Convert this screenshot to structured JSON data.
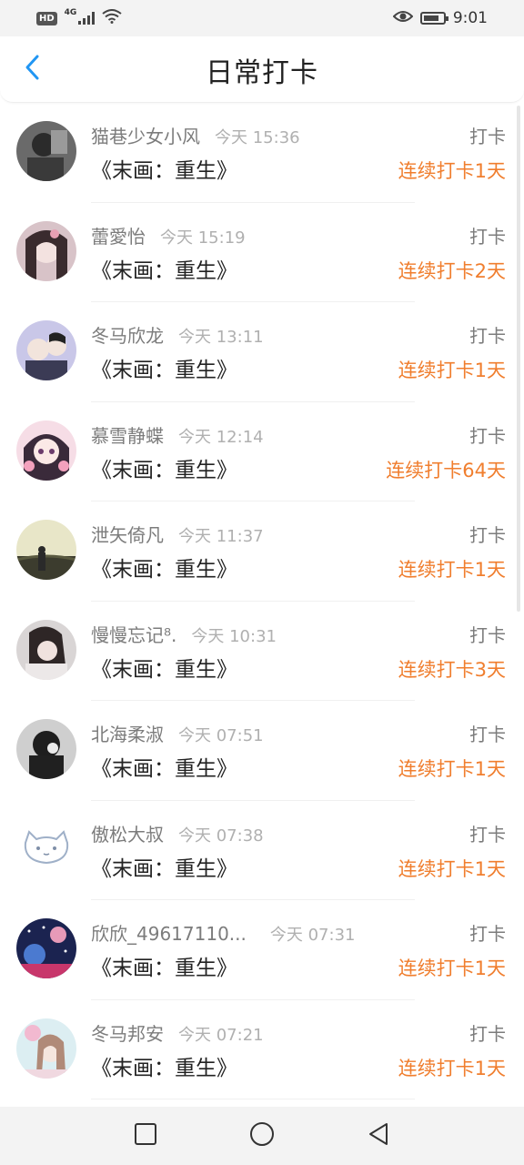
{
  "status_bar": {
    "network": "4G",
    "hd": "HD",
    "time": "9:01"
  },
  "header": {
    "title": "日常打卡",
    "back_icon": "chevron-left-icon"
  },
  "items": [
    {
      "username": "猫巷少女小风",
      "time": "今天 15:36",
      "action": "打卡",
      "book": "《末画：重生》",
      "streak": "连续打卡1天"
    },
    {
      "username": "蕾愛怡",
      "time": "今天 15:19",
      "action": "打卡",
      "book": "《末画：重生》",
      "streak": "连续打卡2天"
    },
    {
      "username": "冬马欣龙",
      "time": "今天 13:11",
      "action": "打卡",
      "book": "《末画：重生》",
      "streak": "连续打卡1天"
    },
    {
      "username": "慕雪静蝶",
      "time": "今天 12:14",
      "action": "打卡",
      "book": "《末画：重生》",
      "streak": "连续打卡64天"
    },
    {
      "username": "泄矢倚凡",
      "time": "今天 11:37",
      "action": "打卡",
      "book": "《末画：重生》",
      "streak": "连续打卡1天"
    },
    {
      "username": "慢慢忘记⁸.",
      "time": "今天 10:31",
      "action": "打卡",
      "book": "《末画：重生》",
      "streak": "连续打卡3天"
    },
    {
      "username": "北海柔淑",
      "time": "今天 07:51",
      "action": "打卡",
      "book": "《末画：重生》",
      "streak": "连续打卡1天"
    },
    {
      "username": "傲松大叔",
      "time": "今天 07:38",
      "action": "打卡",
      "book": "《末画：重生》",
      "streak": "连续打卡1天"
    },
    {
      "username": "欣欣_49617110...",
      "time": "今天 07:31",
      "action": "打卡",
      "book": "《末画：重生》",
      "streak": "连续打卡1天"
    },
    {
      "username": "冬马邦安",
      "time": "今天 07:21",
      "action": "打卡",
      "book": "《末画：重生》",
      "streak": "连续打卡1天"
    }
  ],
  "colors": {
    "accent_back": "#2196f3",
    "streak": "#f07e2e",
    "muted": "#7c7c7c"
  },
  "nav_icons": [
    "recent-apps-icon",
    "home-icon",
    "back-icon"
  ]
}
